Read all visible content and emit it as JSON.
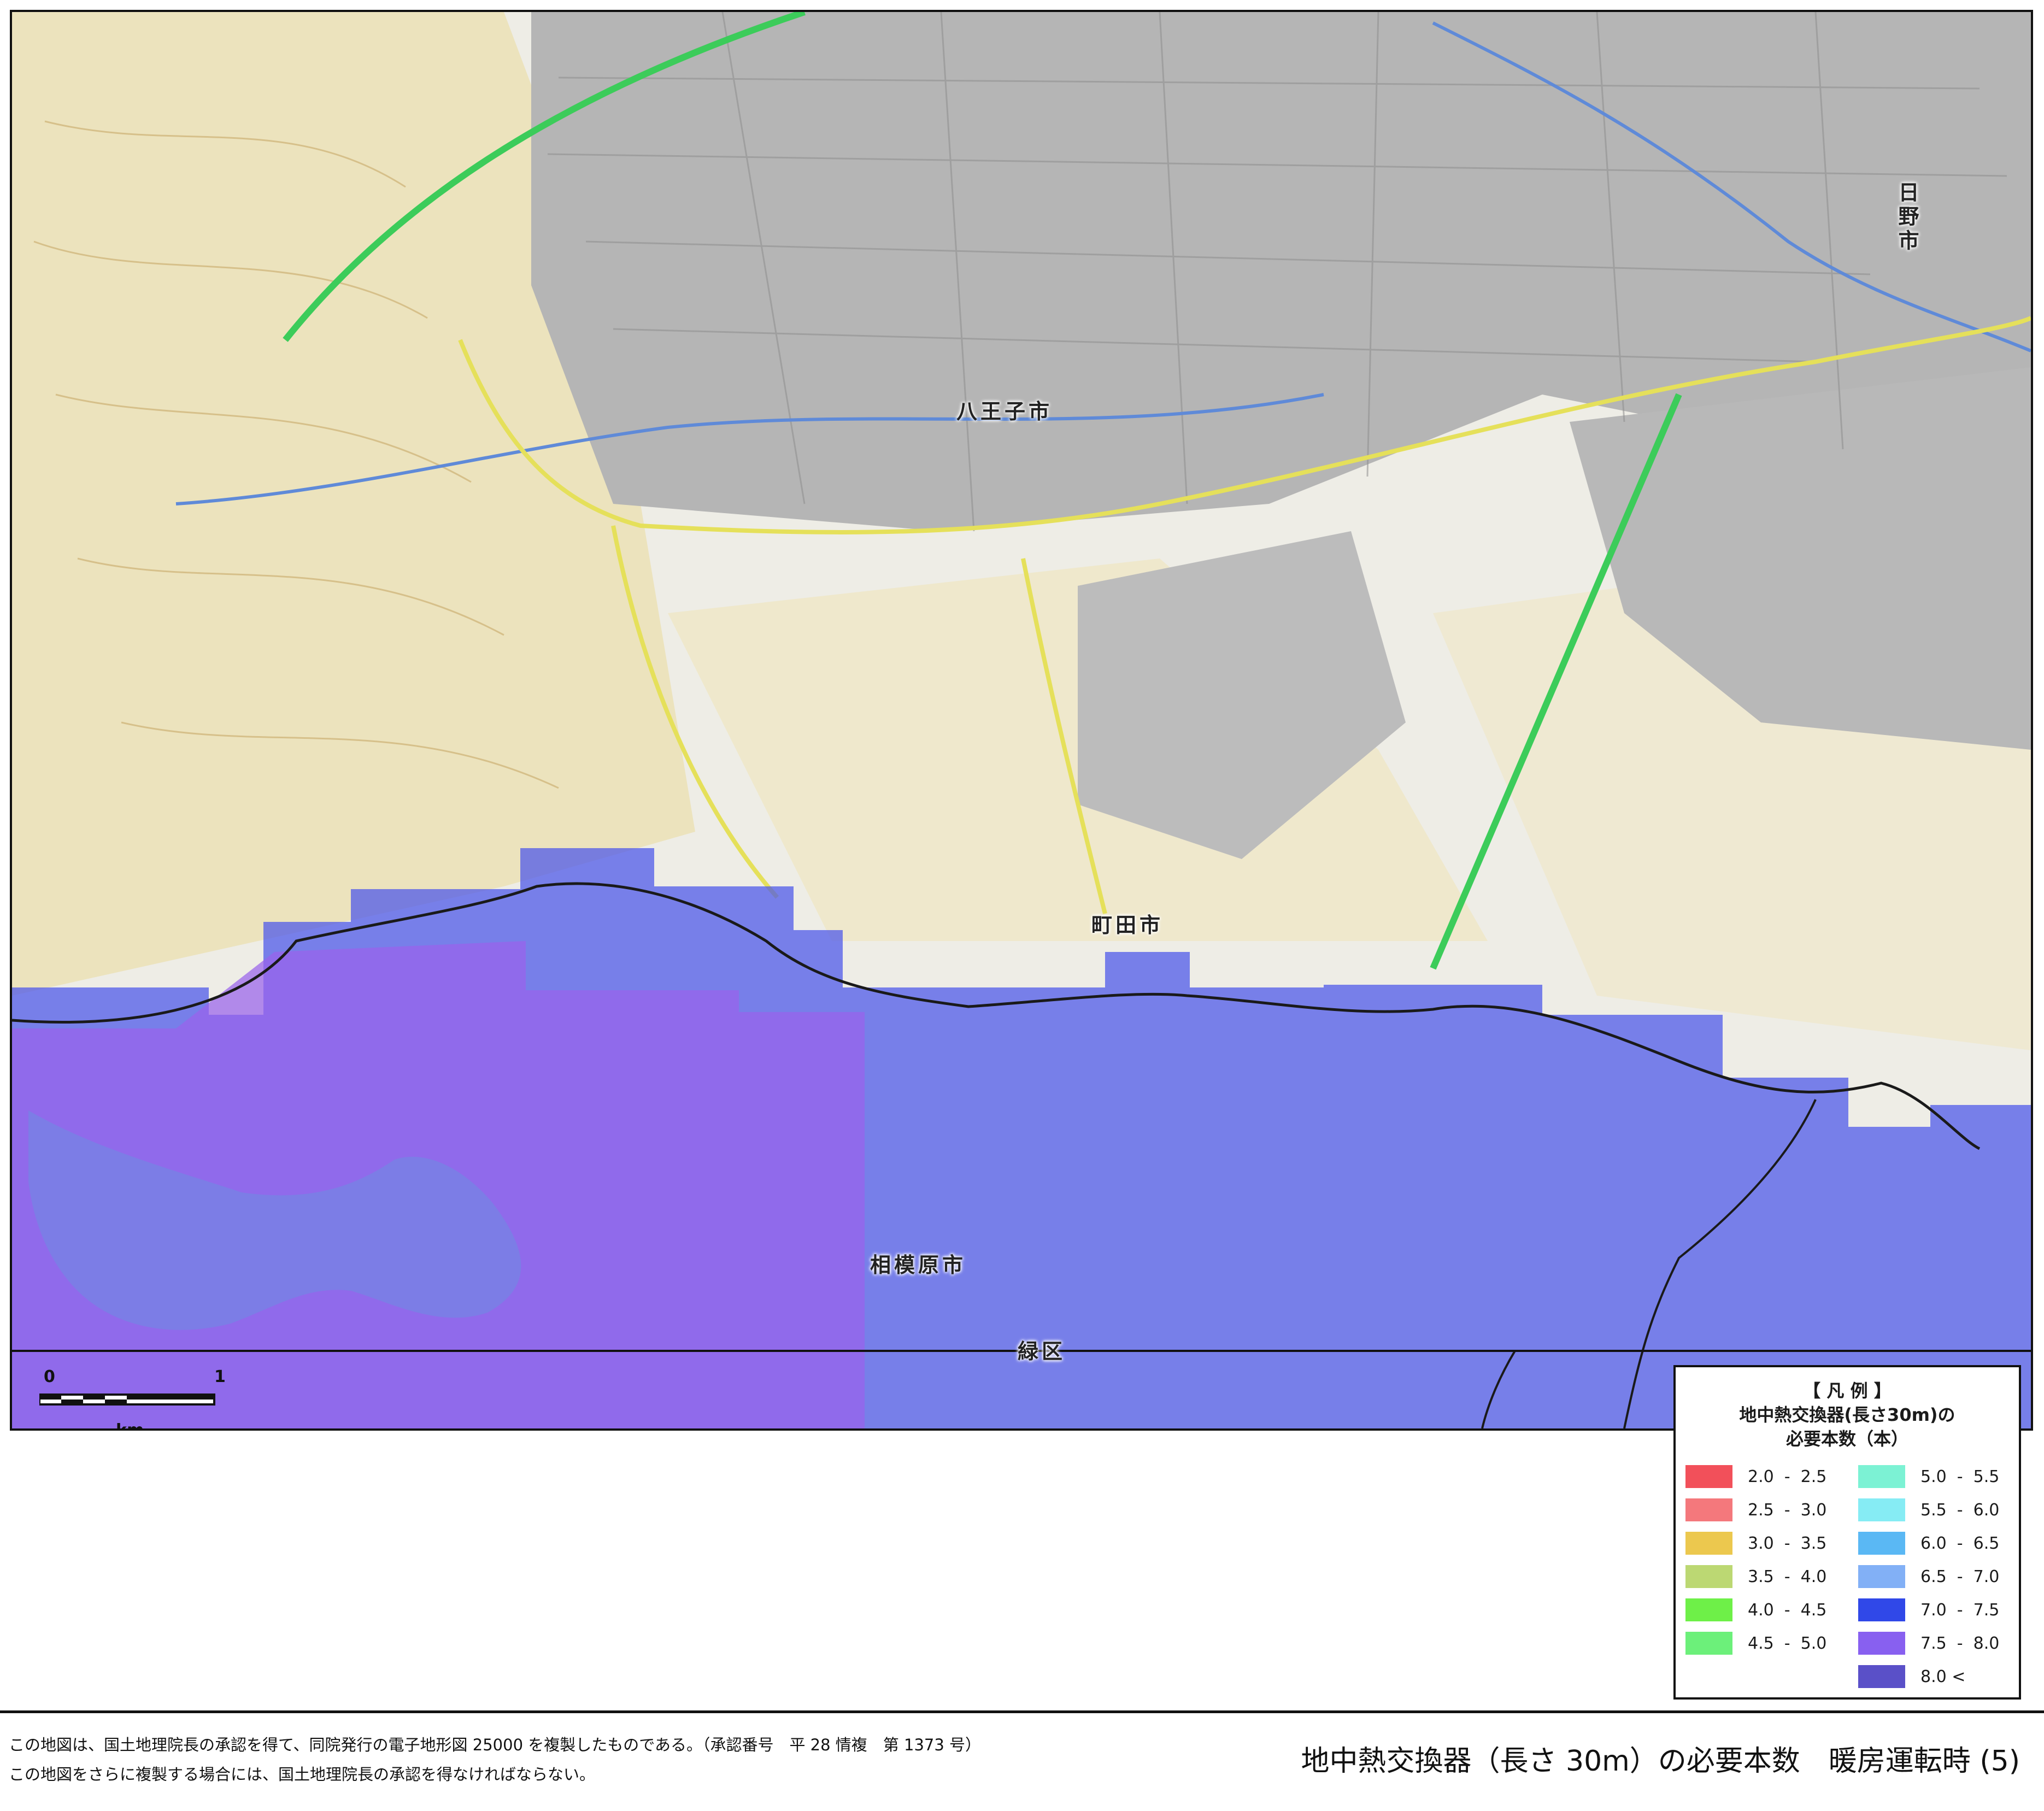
{
  "map": {
    "places": {
      "hachioji": "八王子市",
      "hino": "日野市",
      "machida": "町田市",
      "sagamihara": "相模原市",
      "midori": "緑区"
    },
    "scale": {
      "zero": "0",
      "one": "1",
      "unit": "km"
    }
  },
  "legend": {
    "title": "【 凡 例 】",
    "subtitle_line1": "地中熱交換器(長さ30m)の",
    "subtitle_line2": "必要本数（本）",
    "items": [
      {
        "label": "2.0  -  2.5",
        "color": "#f2505a"
      },
      {
        "label": "2.5  -  3.0",
        "color": "#f4787c"
      },
      {
        "label": "3.0  -  3.5",
        "color": "#ecc84e"
      },
      {
        "label": "3.5  -  4.0",
        "color": "#bcd873"
      },
      {
        "label": "4.0  -  4.5",
        "color": "#6ef048"
      },
      {
        "label": "4.5  -  5.0",
        "color": "#6cf07a"
      },
      {
        "label": "5.0  -  5.5",
        "color": "#7cf2d4"
      },
      {
        "label": "5.5  -  6.0",
        "color": "#86ecf4"
      },
      {
        "label": "6.0  -  6.5",
        "color": "#5ab8f4"
      },
      {
        "label": "6.5  -  7.0",
        "color": "#82b0f6"
      },
      {
        "label": "7.0  -  7.5",
        "color": "#3048e8"
      },
      {
        "label": "7.5  -  8.0",
        "color": "#8860f0"
      },
      {
        "label": "8.0 <",
        "color": "#5a50c8"
      }
    ]
  },
  "footer": {
    "notice_line1": "この地図は、国土地理院長の承認を得て、同院発行の電子地形図 25000 を複製したものである。（承認番号　平 28 情複　第 1373 号）",
    "notice_line2": "この地図をさらに複製する場合には、国土地理院長の承認を得なければならない。",
    "caption": "地中熱交換器（長さ 30m）の必要本数　暖房運転時 (5)"
  }
}
